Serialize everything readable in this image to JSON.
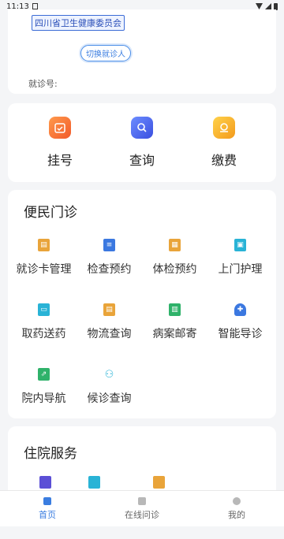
{
  "status": {
    "time": "11:13"
  },
  "user": {
    "org_badge": "四川省卫生健康委员会",
    "switch_button": "切换就诊人",
    "visit_number_label": "就诊号:"
  },
  "quick": [
    {
      "label": "挂号",
      "icon": "register-icon"
    },
    {
      "label": "查询",
      "icon": "search-icon"
    },
    {
      "label": "缴费",
      "icon": "payment-icon"
    }
  ],
  "outpatient": {
    "title": "便民门诊",
    "items": [
      {
        "label": "就诊卡管理",
        "icon": "card-icon"
      },
      {
        "label": "检查预约",
        "icon": "exam-icon"
      },
      {
        "label": "体检预约",
        "icon": "checkup-icon"
      },
      {
        "label": "上门护理",
        "icon": "nursing-icon"
      },
      {
        "label": "取药送药",
        "icon": "medicine-icon"
      },
      {
        "label": "物流查询",
        "icon": "logistics-icon"
      },
      {
        "label": "病案邮寄",
        "icon": "record-mail-icon"
      },
      {
        "label": "智能导诊",
        "icon": "smart-guide-icon"
      },
      {
        "label": "院内导航",
        "icon": "navigation-icon"
      },
      {
        "label": "候诊查询",
        "icon": "waiting-icon"
      }
    ]
  },
  "inpatient": {
    "title": "住院服务"
  },
  "nav": {
    "home": "首页",
    "consult": "在线问诊",
    "mine": "我的"
  },
  "colors": {
    "accent": "#3a7de0"
  }
}
